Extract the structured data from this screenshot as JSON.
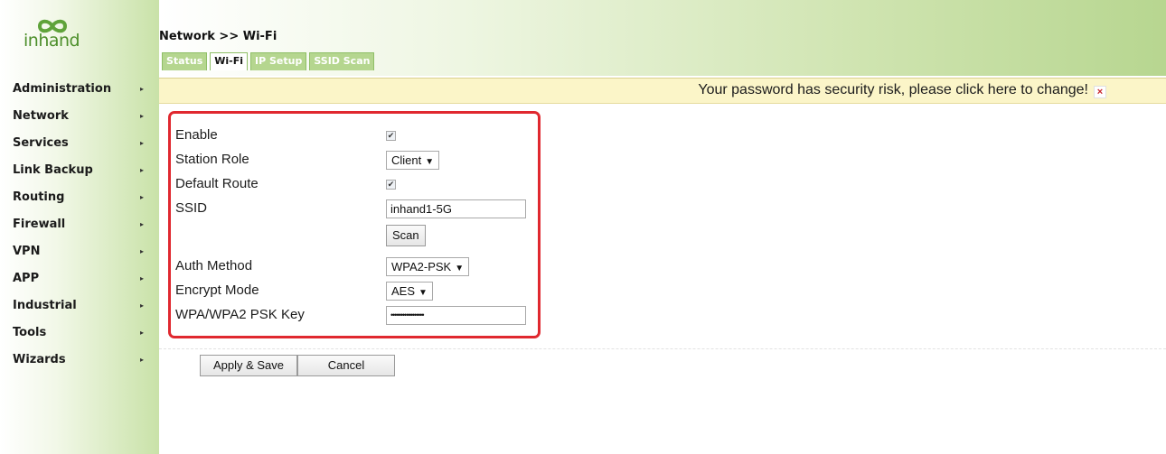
{
  "brand": {
    "logo_text": "inhand",
    "accent": "#4d8f2b",
    "panel_highlight": "#e0282f"
  },
  "sidebar": {
    "items": [
      {
        "label": "Administration"
      },
      {
        "label": "Network"
      },
      {
        "label": "Services"
      },
      {
        "label": "Link Backup"
      },
      {
        "label": "Routing"
      },
      {
        "label": "Firewall"
      },
      {
        "label": "VPN"
      },
      {
        "label": "APP"
      },
      {
        "label": "Industrial"
      },
      {
        "label": "Tools"
      },
      {
        "label": "Wizards"
      }
    ],
    "arrow_glyph": "▸"
  },
  "header": {
    "breadcrumb": "Network >> Wi-Fi",
    "tabs": [
      {
        "label": "Status",
        "active": false
      },
      {
        "label": "Wi-Fi",
        "active": true
      },
      {
        "label": "IP Setup",
        "active": false
      },
      {
        "label": "SSID Scan",
        "active": false
      }
    ]
  },
  "warning": {
    "text": "Your password has security risk, please click here to change!",
    "close_glyph": "×"
  },
  "form": {
    "enable": {
      "label": "Enable",
      "checked": true
    },
    "station_role": {
      "label": "Station Role",
      "value": "Client"
    },
    "default_route": {
      "label": "Default Route",
      "checked": true
    },
    "ssid": {
      "label": "SSID",
      "value": "inhand1-5G"
    },
    "scan_button": "Scan",
    "auth_method": {
      "label": "Auth Method",
      "value": "WPA2-PSK"
    },
    "encrypt_mode": {
      "label": "Encrypt Mode",
      "value": "AES"
    },
    "psk_key": {
      "label": "WPA/WPA2 PSK Key",
      "masked_value": "•••••••••••••••••"
    }
  },
  "actions": {
    "apply_label": "Apply & Save",
    "cancel_label": "Cancel"
  },
  "glyphs": {
    "check": "✔",
    "caret": "▼"
  }
}
